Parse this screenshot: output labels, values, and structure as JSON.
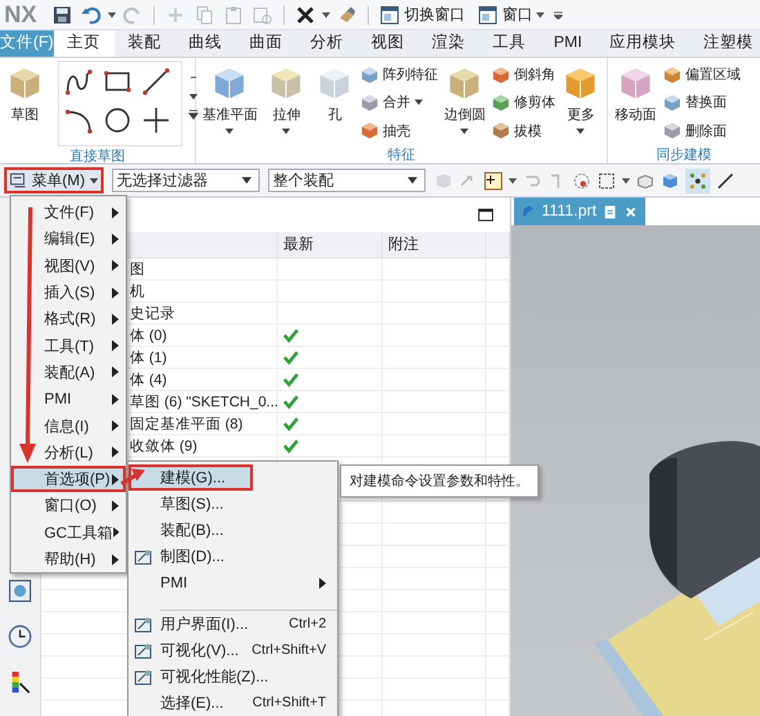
{
  "title_bar": {
    "logo": "NX",
    "buttons": [
      {
        "label": "切换窗口",
        "has_menu": false
      },
      {
        "label": "窗口",
        "has_menu": true
      }
    ]
  },
  "ribbon_tabs": [
    {
      "label": "文件(F)",
      "kind": "file",
      "selected": false
    },
    {
      "label": "主页",
      "kind": "tab",
      "selected": true
    },
    {
      "label": "装配",
      "kind": "tab",
      "selected": false
    },
    {
      "label": "曲线",
      "kind": "tab",
      "selected": false
    },
    {
      "label": "曲面",
      "kind": "tab",
      "selected": false
    },
    {
      "label": "分析",
      "kind": "tab",
      "selected": false
    },
    {
      "label": "视图",
      "kind": "tab",
      "selected": false
    },
    {
      "label": "渲染",
      "kind": "tab",
      "selected": false
    },
    {
      "label": "工具",
      "kind": "tab",
      "selected": false
    },
    {
      "label": "PMI",
      "kind": "tab",
      "selected": false
    },
    {
      "label": "应用模块",
      "kind": "tab",
      "selected": false
    },
    {
      "label": "注塑模",
      "kind": "tab",
      "selected": false
    }
  ],
  "ribbon_groups": [
    {
      "title": "直接草图",
      "columns": [
        {
          "kind": "large",
          "label": "草图",
          "has_menu": false
        },
        {
          "kind": "tools"
        }
      ]
    },
    {
      "title": "特征",
      "columns": [
        {
          "kind": "large",
          "label": "基准平面",
          "has_menu": true
        },
        {
          "kind": "large",
          "label": "拉伸",
          "has_menu": true
        },
        {
          "kind": "large",
          "label": "孔",
          "has_menu": false
        },
        {
          "kind": "small",
          "items": [
            {
              "label": "阵列特征",
              "has_menu": false
            },
            {
              "label": "合并",
              "has_menu": true
            },
            {
              "label": "抽壳",
              "has_menu": false
            }
          ]
        },
        {
          "kind": "large",
          "label": "边倒圆",
          "has_menu": true
        },
        {
          "kind": "small",
          "items": [
            {
              "label": "倒斜角",
              "has_menu": false
            },
            {
              "label": "修剪体",
              "has_menu": false
            },
            {
              "label": "拔模",
              "has_menu": false
            }
          ]
        },
        {
          "kind": "large",
          "label": "更多",
          "has_menu": true
        }
      ]
    },
    {
      "title": "同步建模",
      "columns": [
        {
          "kind": "large",
          "label": "移动面",
          "has_menu": false
        },
        {
          "kind": "small",
          "items": [
            {
              "label": "偏置区域",
              "has_menu": false
            },
            {
              "label": "替换面",
              "has_menu": false
            },
            {
              "label": "删除面",
              "has_menu": false
            }
          ]
        }
      ]
    }
  ],
  "toolbar": {
    "menu_button": {
      "label": "菜单(M)",
      "marked": true
    },
    "filters": [
      "无选择过滤器",
      "整个装配"
    ]
  },
  "navigator": {
    "columns": [
      "最新",
      "附注"
    ],
    "rows": [
      {
        "name": "图",
        "latest": false
      },
      {
        "name": "机",
        "latest": false
      },
      {
        "name": "史记录",
        "latest": false
      },
      {
        "name": "体 (0)",
        "latest": true
      },
      {
        "name": "体 (1)",
        "latest": true
      },
      {
        "name": "体 (4)",
        "latest": true
      },
      {
        "name": "草图 (6) \"SKETCH_0...",
        "latest": true
      },
      {
        "name": "固定基准平面 (8)",
        "latest": true
      },
      {
        "name": "收敛体 (9)",
        "latest": true
      }
    ]
  },
  "graphics": {
    "tab": "1111.prt"
  },
  "main_menu": {
    "items": [
      {
        "label": "文件(F)",
        "selected": false,
        "marked": false
      },
      {
        "label": "编辑(E)",
        "selected": false,
        "marked": false
      },
      {
        "label": "视图(V)",
        "selected": false,
        "marked": false
      },
      {
        "label": "插入(S)",
        "selected": false,
        "marked": false
      },
      {
        "label": "格式(R)",
        "selected": false,
        "marked": false
      },
      {
        "label": "工具(T)",
        "selected": false,
        "marked": false
      },
      {
        "label": "装配(A)",
        "selected": false,
        "marked": false
      },
      {
        "label": "PMI",
        "selected": false,
        "marked": false
      },
      {
        "label": "信息(I)",
        "selected": false,
        "marked": false
      },
      {
        "label": "分析(L)",
        "selected": false,
        "marked": false
      },
      {
        "label": "首选项(P)",
        "selected": true,
        "marked": true
      },
      {
        "label": "窗口(O)",
        "selected": false,
        "marked": false
      },
      {
        "label": "GC工具箱",
        "selected": false,
        "marked": false
      },
      {
        "label": "帮助(H)",
        "selected": false,
        "marked": false
      }
    ]
  },
  "submenu": {
    "items": [
      {
        "label": "建模(G)...",
        "selected": true,
        "marked": true,
        "has_icon": false,
        "has_submenu": false,
        "separator_before": false
      },
      {
        "label": "草图(S)...",
        "selected": false,
        "marked": false,
        "has_icon": false,
        "has_submenu": false,
        "separator_before": false
      },
      {
        "label": "装配(B)...",
        "selected": false,
        "marked": false,
        "has_icon": false,
        "has_submenu": false,
        "separator_before": false
      },
      {
        "label": "制图(D)...",
        "selected": false,
        "marked": false,
        "has_icon": true,
        "has_submenu": false,
        "separator_before": false
      },
      {
        "label": "PMI",
        "selected": false,
        "marked": false,
        "has_icon": false,
        "has_submenu": true,
        "separator_before": false
      },
      {
        "label": "用户界面(I)...",
        "shortcut": "Ctrl+2",
        "selected": false,
        "marked": false,
        "has_icon": true,
        "has_submenu": false,
        "separator_before": true
      },
      {
        "label": "可视化(V)...",
        "shortcut": "Ctrl+Shift+V",
        "selected": false,
        "marked": false,
        "has_icon": true,
        "has_submenu": false,
        "separator_before": false
      },
      {
        "label": "可视化性能(Z)...",
        "selected": false,
        "marked": false,
        "has_icon": true,
        "has_submenu": false,
        "separator_before": false
      },
      {
        "label": "选择(E)...",
        "shortcut": "Ctrl+Shift+T",
        "selected": false,
        "marked": false,
        "has_icon": false,
        "has_submenu": false,
        "separator_before": false
      }
    ]
  },
  "tooltip": "对建模命令设置参数和特性。"
}
